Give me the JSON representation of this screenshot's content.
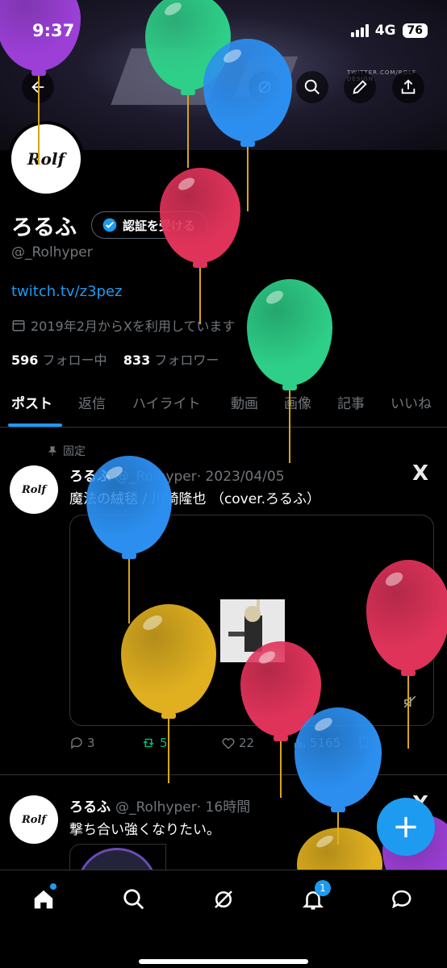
{
  "status_bar": {
    "time": "9:37",
    "network": "4G",
    "battery": "76"
  },
  "banner": {
    "text": "TWITTER.COM/ROLF DESIGN"
  },
  "profile": {
    "name": "ろるふ",
    "verify_button": "認証を受ける",
    "handle": "@_Rolhyper",
    "link": "twitch.tv/z3pez",
    "joined": "2019年2月からXを利用しています",
    "following_count": "596",
    "following_label": "フォロー中",
    "followers_count": "833",
    "followers_label": "フォロワー",
    "avatar_text": "Rolf"
  },
  "tabs": [
    "ポスト",
    "返信",
    "ハイライト",
    "動画",
    "画像",
    "記事",
    "いいね"
  ],
  "posts": [
    {
      "pinned_label": "固定",
      "name": "ろるふ",
      "handle": "@_Rolhyper",
      "time": "· 2023/04/05",
      "text": "魔法の絨毯 / 川崎隆也 （cover.ろるふ）",
      "replies": "3",
      "reposts": "5",
      "likes": "22",
      "views": "5165"
    },
    {
      "name": "ろるふ",
      "handle": "@_Rolhyper",
      "time": "· 16時間",
      "text": "撃ち合い強くなりたい。"
    }
  ],
  "fab": {
    "label": "+"
  },
  "bottom_nav": {
    "notifications_badge": "1"
  },
  "icons": [
    "back-arrow-icon",
    "search-icon",
    "edit-icon",
    "share-icon",
    "verified-icon",
    "calendar-icon",
    "pin-icon",
    "x-logo-icon",
    "reply-icon",
    "repost-icon",
    "like-icon",
    "views-icon",
    "bookmark-icon",
    "mute-icon",
    "home-icon",
    "explore-icon",
    "grok-icon",
    "bell-icon",
    "message-icon"
  ],
  "colors": {
    "accent": "#1d9bf0",
    "repost": "#00ba7c",
    "background": "#000000"
  },
  "balloons": [
    "purple",
    "green",
    "blue",
    "red",
    "green",
    "blue",
    "yellow",
    "red",
    "red",
    "blue",
    "yellow",
    "purple"
  ]
}
